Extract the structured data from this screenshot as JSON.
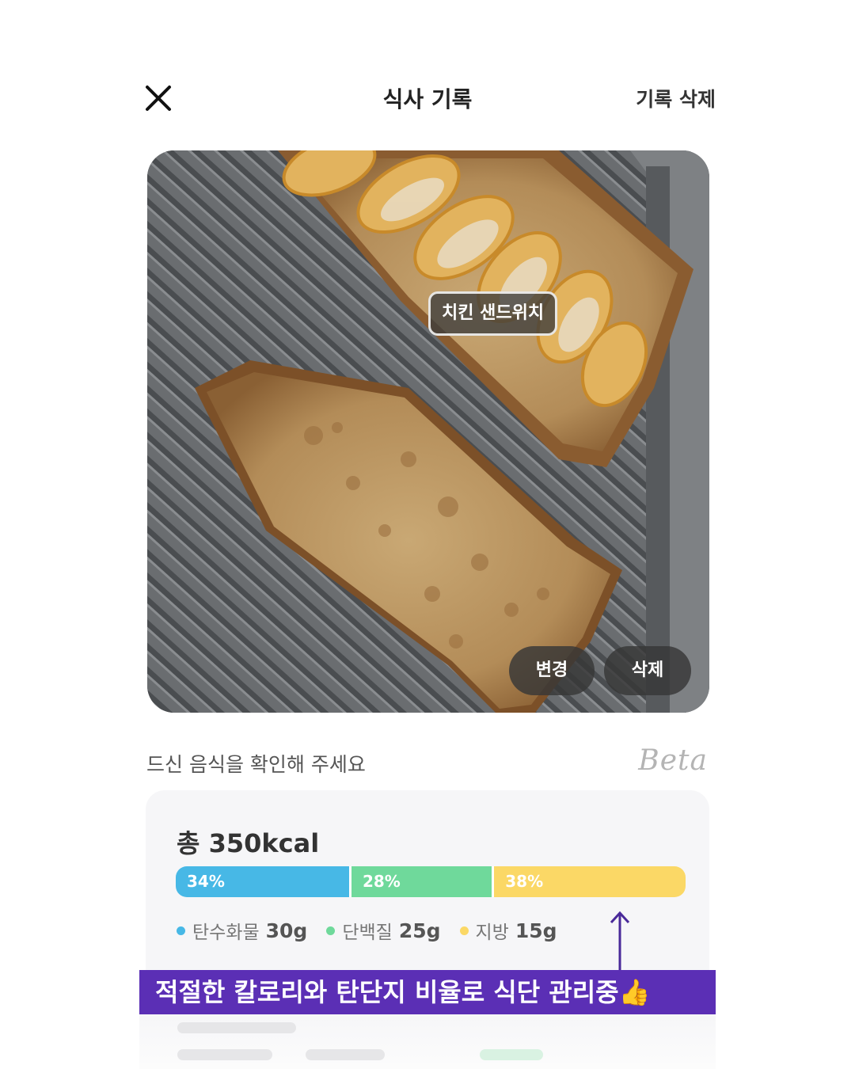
{
  "header": {
    "title": "식사 기록",
    "delete_label": "기록 삭제"
  },
  "photo": {
    "food_tag": "치킨 샌드위치",
    "change_label": "변경",
    "delete_label": "삭제"
  },
  "confirm": {
    "text": "드신 음식을 확인해 주세요",
    "beta": "Beta"
  },
  "nutrition": {
    "total": "총 350kcal",
    "segments": [
      {
        "label": "34%",
        "percent": 34,
        "color": "#47b8e6"
      },
      {
        "label": "28%",
        "percent": 28,
        "color": "#6fd99b"
      },
      {
        "label": "38%",
        "percent": 38,
        "color": "#fbd866"
      }
    ],
    "legend": [
      {
        "name": "탄수화물",
        "value": "30g",
        "color": "#47b8e6"
      },
      {
        "name": "단백질",
        "value": "25g",
        "color": "#6fd99b"
      },
      {
        "name": "지방",
        "value": "15g",
        "color": "#fbd866"
      }
    ]
  },
  "annotation": {
    "text": "적절한 칼로리와 탄단지 비율로 식단 관리중👍"
  }
}
